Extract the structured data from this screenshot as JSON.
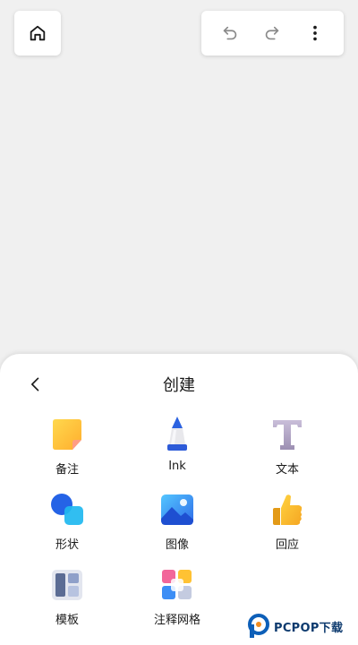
{
  "topbar": {
    "home_icon": "home-icon",
    "undo_icon": "undo-icon",
    "redo_icon": "redo-icon",
    "more_icon": "more-vertical-icon"
  },
  "sheet": {
    "title": "创建",
    "back_icon": "chevron-left-icon",
    "items": [
      {
        "label": "备注",
        "icon": "sticky-note-icon"
      },
      {
        "label": "Ink",
        "icon": "ink-pen-icon"
      },
      {
        "label": "文本",
        "icon": "text-icon"
      },
      {
        "label": "形状",
        "icon": "shapes-icon"
      },
      {
        "label": "图像",
        "icon": "image-icon"
      },
      {
        "label": "回应",
        "icon": "thumbs-up-icon"
      },
      {
        "label": "模板",
        "icon": "template-icon"
      },
      {
        "label": "注释网格",
        "icon": "note-grid-icon"
      }
    ]
  },
  "watermark": {
    "text": "PCPOP下载"
  },
  "colors": {
    "background": "#f0f0f0",
    "surface": "#ffffff",
    "text": "#1a1a1a",
    "icon_gray": "#8a8a8a"
  }
}
